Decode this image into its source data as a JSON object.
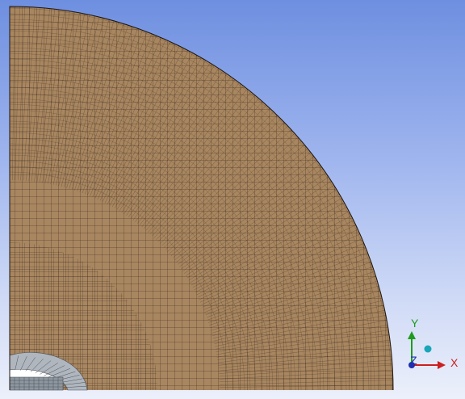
{
  "viewport": {
    "background_top": "#6e8fe0",
    "background_bottom": "#ecf0fb"
  },
  "mesh": {
    "fill_color": "#a88660",
    "line_color": "#2e2116",
    "inner_ring_fill": "#b0b6bd",
    "inner_ring_line": "#4a525a"
  },
  "triad": {
    "x_label": "X",
    "y_label": "Y",
    "z_label": "Z",
    "x_color": "#cc1f1f",
    "y_color": "#1f9b1f",
    "z_color": "#1f2fb0",
    "iso_ball_color": "#18a6b8"
  }
}
